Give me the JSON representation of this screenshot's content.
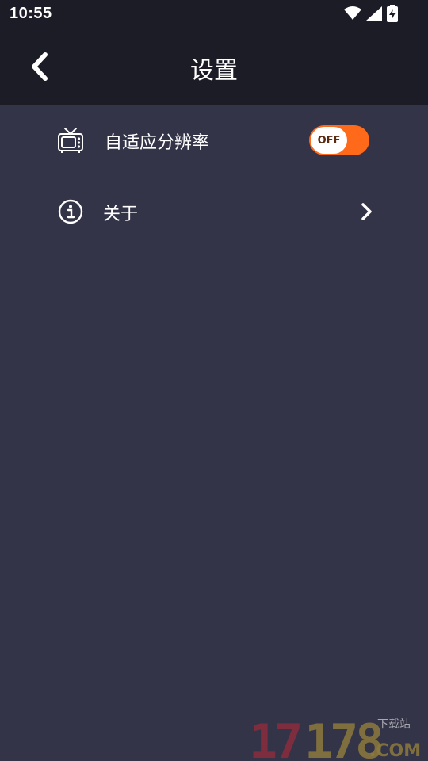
{
  "status_bar": {
    "time": "10:55",
    "icons": [
      "wifi-icon",
      "cell-signal-icon",
      "battery-charging-icon"
    ]
  },
  "app_bar": {
    "back_icon": "chevron-left-icon",
    "title": "设置"
  },
  "settings": [
    {
      "icon": "tv-icon",
      "label": "自适应分辨率",
      "control": "toggle",
      "toggle_text": "OFF",
      "toggle_color": "#ff6a1a"
    },
    {
      "icon": "info-icon",
      "label": "关于",
      "control": "chevron-right-icon"
    }
  ],
  "watermark": {
    "number": "17178",
    "suffix": ".COM",
    "tag": "下载站"
  },
  "colors": {
    "header_bg": "#1c1c26",
    "content_bg": "#343449",
    "accent": "#ff6a1a"
  }
}
